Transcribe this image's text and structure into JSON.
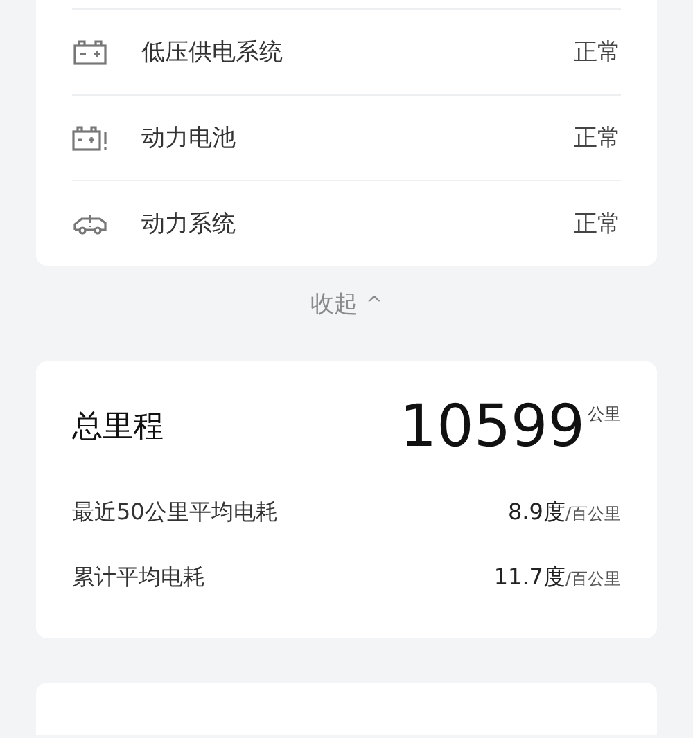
{
  "status_items": [
    {
      "kind": "battery",
      "label": "低压供电系统",
      "value": "正常"
    },
    {
      "kind": "battery-alert",
      "label": "动力电池",
      "value": "正常"
    },
    {
      "kind": "car-alert",
      "label": "动力系统",
      "value": "正常"
    }
  ],
  "collapse": {
    "label": "收起",
    "symbol": "^"
  },
  "mileage": {
    "title": "总里程",
    "value": "10599",
    "unit": "公里",
    "rows": [
      {
        "label": "最近50公里平均电耗",
        "value": "8.9度",
        "unit": "/百公里"
      },
      {
        "label": "累计平均电耗",
        "value": "11.7度",
        "unit": "/百公里"
      }
    ]
  }
}
